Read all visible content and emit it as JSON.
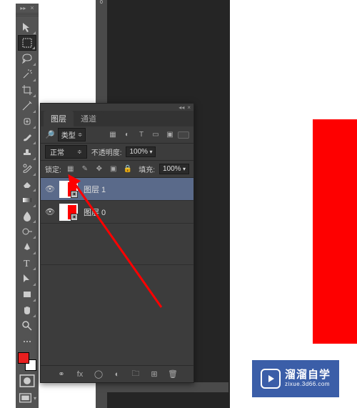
{
  "colors": {
    "foreground": "#e81f1f",
    "red_shape": "#fe0000",
    "badge_bg": "#3b5ea8"
  },
  "ruler": {
    "tick": "0"
  },
  "panel": {
    "tab_layers": "图层",
    "tab_channels": "通道",
    "type_filter": "类型",
    "blend_mode": "正常",
    "opacity_label": "不透明度:",
    "opacity_value": "100%",
    "lock_label": "锁定:",
    "fill_label": "填充:",
    "fill_value": "100%"
  },
  "layers": [
    {
      "name": "图层 1",
      "visible": true,
      "selected": true,
      "thumb_fill_right": "#fe0000",
      "smart": true
    },
    {
      "name": "图层 0",
      "visible": true,
      "selected": false,
      "thumb_fill_right": "#fe0000",
      "smart": true
    }
  ],
  "badge": {
    "title": "溜溜自学",
    "url": "zixue.3d66.com"
  }
}
